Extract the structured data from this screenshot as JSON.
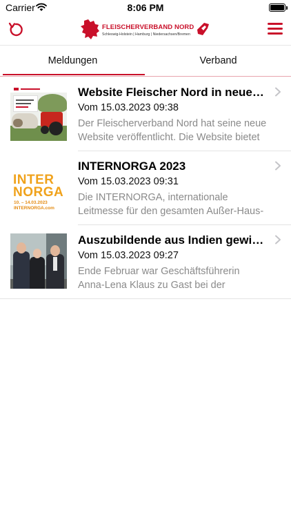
{
  "status_bar": {
    "carrier": "Carrier",
    "time": "8:06 PM"
  },
  "nav": {
    "logo_title": "FLEISCHERVERBAND NORD",
    "logo_subtitle": "Schleswig-Holstein | Hamburg | Niedersachsen/Bremen",
    "refresh_icon": "refresh-icon",
    "menu_icon": "hamburger-menu-icon"
  },
  "tabs": [
    {
      "label": "Meldungen",
      "selected": true
    },
    {
      "label": "Verband",
      "selected": false
    }
  ],
  "news": [
    {
      "title": "Website Fleischer Nord in neue…",
      "date": "Vom 15.03.2023 09:38",
      "excerpt_line1": "Der Fleischerverband Nord hat seine neue",
      "excerpt_line2": "Website veröffentlicht. Die Website bietet",
      "thumbnail": "website-screenshot-thumbnail"
    },
    {
      "title": "INTERNORGA 2023",
      "date": "Vom 15.03.2023 09:31",
      "excerpt_line1": "Die INTERNORGA, internationale",
      "excerpt_line2": "Leitmesse für den gesamten Außer-Haus-",
      "thumbnail": "internorga-logo-thumbnail",
      "thumb_text_line1": "INTER",
      "thumb_text_line2": "NORGA",
      "thumb_text_dates": "10. – 14.03.2023",
      "thumb_text_url": "INTERNORGA.com"
    },
    {
      "title": "Auszubildende aus Indien gewi…",
      "date": "Vom 15.03.2023 09:27",
      "excerpt_line1": "Ende Februar war Geschäftsführerin",
      "excerpt_line2": "Anna-Lena Klaus zu Gast bei der",
      "thumbnail": "group-photo-thumbnail"
    }
  ],
  "colors": {
    "accent": "#c9102a",
    "secondary_text": "#8a8a8a",
    "internorga_orange": "#f0a21b"
  }
}
